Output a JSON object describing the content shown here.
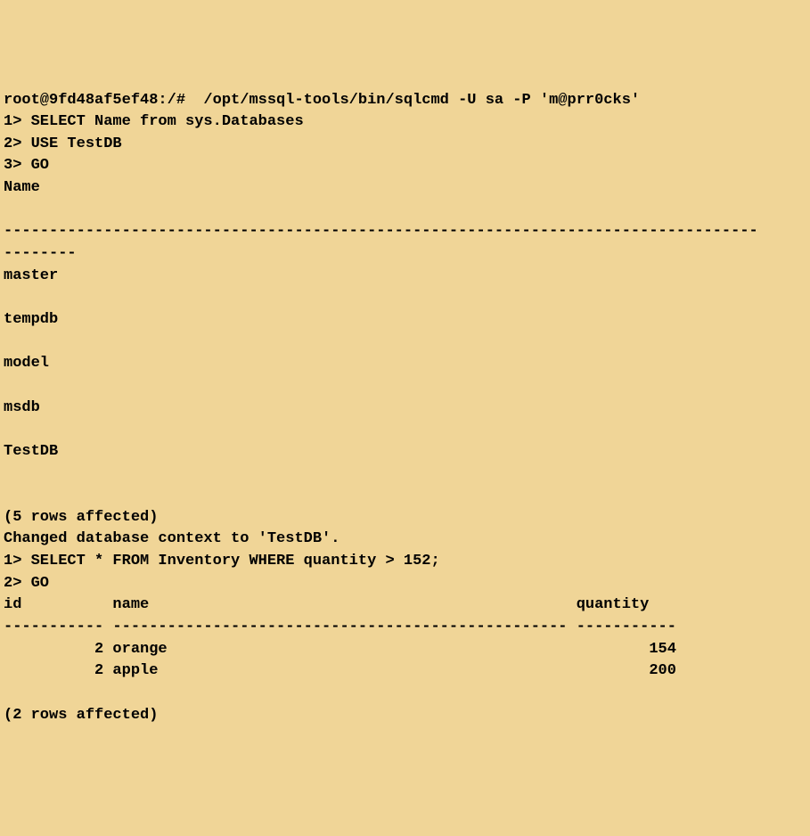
{
  "terminal": {
    "line0": "root@9fd48af5ef48:/#  /opt/mssql-tools/bin/sqlcmd -U sa -P 'm@prr0cks'",
    "line1": "1> SELECT Name from sys.Databases",
    "line2": "2> USE TestDB",
    "line3": "3> GO",
    "line4": "Name",
    "line5": "",
    "line6": "-----------------------------------------------------------------------------------",
    "line7": "--------",
    "line8": "master",
    "line9": "",
    "line10": "tempdb",
    "line11": "",
    "line12": "model",
    "line13": "",
    "line14": "msdb",
    "line15": "",
    "line16": "TestDB",
    "line17": "",
    "line18": "",
    "line19": "(5 rows affected)",
    "line20": "Changed database context to 'TestDB'.",
    "line21": "1> SELECT * FROM Inventory WHERE quantity > 152;",
    "line22": "2> GO",
    "line23": "id          name                                               quantity",
    "line24": "----------- -------------------------------------------------- -----------",
    "line25": "          2 orange                                                     154",
    "line26": "          2 apple                                                      200",
    "line27": "",
    "line28": "(2 rows affected)"
  }
}
